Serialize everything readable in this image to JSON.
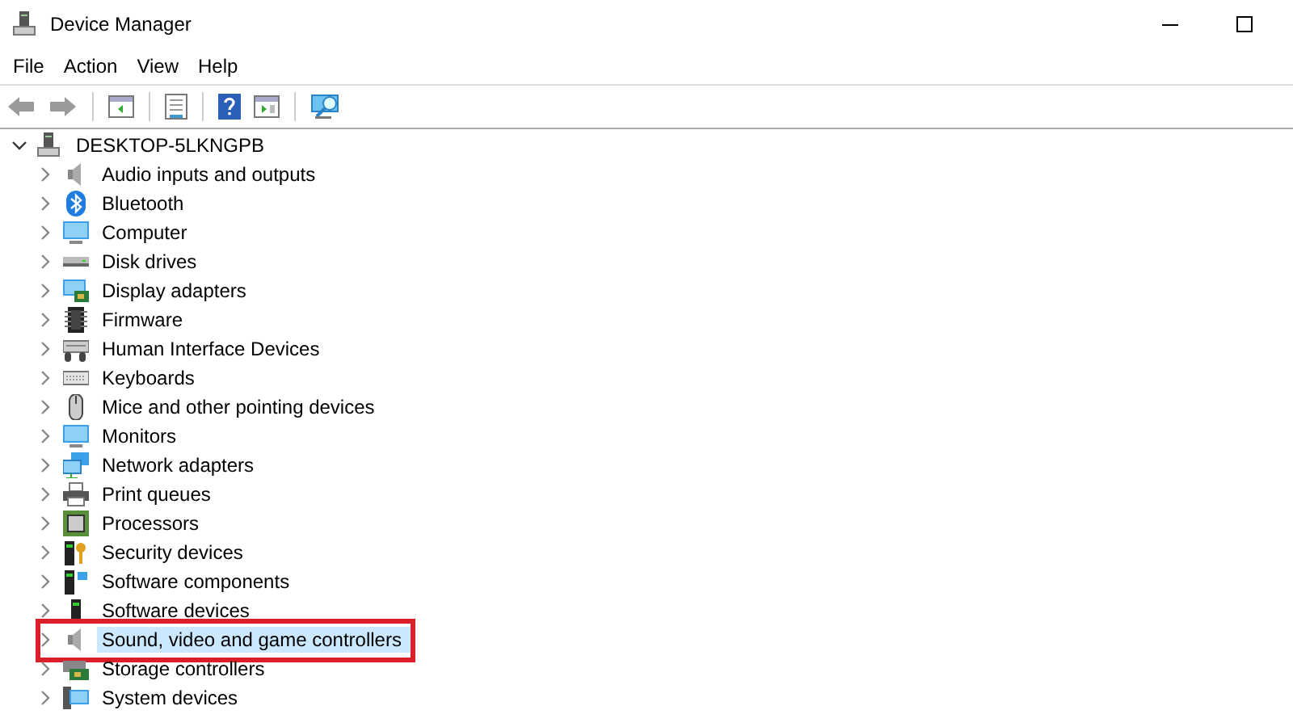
{
  "window": {
    "title": "Device Manager"
  },
  "menu": [
    {
      "label": "File"
    },
    {
      "label": "Action"
    },
    {
      "label": "View"
    },
    {
      "label": "Help"
    }
  ],
  "tree": {
    "label": "DESKTOP-5LKNGPB",
    "expanded": true,
    "children": [
      {
        "label": "Audio inputs and outputs",
        "expanded": false,
        "selected": false,
        "annotated": false
      },
      {
        "label": "Bluetooth",
        "expanded": false,
        "selected": false,
        "annotated": false
      },
      {
        "label": "Computer",
        "expanded": false,
        "selected": false,
        "annotated": false
      },
      {
        "label": "Disk drives",
        "expanded": false,
        "selected": false,
        "annotated": false
      },
      {
        "label": "Display adapters",
        "expanded": false,
        "selected": false,
        "annotated": false
      },
      {
        "label": "Firmware",
        "expanded": false,
        "selected": false,
        "annotated": false
      },
      {
        "label": "Human Interface Devices",
        "expanded": false,
        "selected": false,
        "annotated": false
      },
      {
        "label": "Keyboards",
        "expanded": false,
        "selected": false,
        "annotated": false
      },
      {
        "label": "Mice and other pointing devices",
        "expanded": false,
        "selected": false,
        "annotated": false
      },
      {
        "label": "Monitors",
        "expanded": false,
        "selected": false,
        "annotated": false
      },
      {
        "label": "Network adapters",
        "expanded": false,
        "selected": false,
        "annotated": false
      },
      {
        "label": "Print queues",
        "expanded": false,
        "selected": false,
        "annotated": false
      },
      {
        "label": "Processors",
        "expanded": false,
        "selected": false,
        "annotated": false
      },
      {
        "label": "Security devices",
        "expanded": false,
        "selected": false,
        "annotated": false
      },
      {
        "label": "Software components",
        "expanded": false,
        "selected": false,
        "annotated": false
      },
      {
        "label": "Software devices",
        "expanded": false,
        "selected": false,
        "annotated": false
      },
      {
        "label": "Sound, video and game controllers",
        "expanded": false,
        "selected": true,
        "annotated": true
      },
      {
        "label": "Storage controllers",
        "expanded": false,
        "selected": false,
        "annotated": false
      },
      {
        "label": "System devices",
        "expanded": false,
        "selected": false,
        "annotated": false
      }
    ]
  }
}
